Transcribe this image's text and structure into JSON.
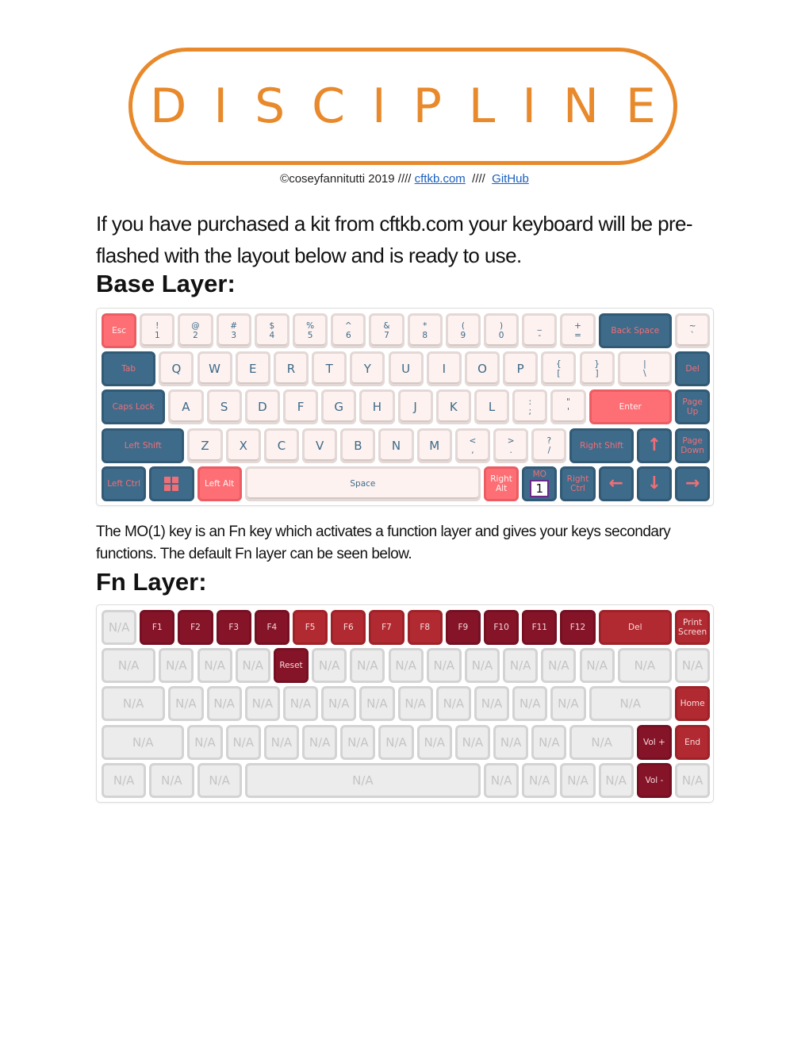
{
  "logo": {
    "text": "DISCIPLINE",
    "color": "#e8892b"
  },
  "credits": {
    "prefix": "©coseyfannitutti 2019 //// ",
    "link1": "cftkb.com",
    "sep": "  ////  ",
    "link2": "GitHub"
  },
  "intro": "If you have purchased a kit from cftkb.com your keyboard will be pre-flashed with the layout below and is ready to use.",
  "base_heading": "Base Layer:",
  "mo_paragraph": "The MO(1) key is an Fn key which activates a function layer and gives your keys secondary functions. The default Fn layer can be seen below.",
  "fn_heading": "Fn Layer:",
  "colors": {
    "navy": "#3e6b8a",
    "coral": "#fd6f75",
    "cream": "#fdf2ef",
    "maroon": "#861429",
    "crimson": "#b12a31",
    "gray": "#ececec"
  },
  "base_layer": [
    [
      {
        "label": "Esc",
        "style": "red"
      },
      {
        "top": "!",
        "bottom": "1",
        "style": "light"
      },
      {
        "top": "@",
        "bottom": "2",
        "style": "light"
      },
      {
        "top": "#",
        "bottom": "3",
        "style": "light"
      },
      {
        "top": "$",
        "bottom": "4",
        "style": "light"
      },
      {
        "top": "%",
        "bottom": "5",
        "style": "light"
      },
      {
        "top": "^",
        "bottom": "6",
        "style": "light"
      },
      {
        "top": "&",
        "bottom": "7",
        "style": "light"
      },
      {
        "top": "*",
        "bottom": "8",
        "style": "light"
      },
      {
        "top": "(",
        "bottom": "9",
        "style": "light"
      },
      {
        "top": ")",
        "bottom": "0",
        "style": "light"
      },
      {
        "top": "_",
        "bottom": "-",
        "style": "light"
      },
      {
        "top": "+",
        "bottom": "=",
        "style": "light"
      },
      {
        "label": "Back Space",
        "style": "blue"
      },
      {
        "top": "~",
        "bottom": "`",
        "style": "light"
      }
    ],
    [
      {
        "label": "Tab",
        "style": "blue"
      },
      {
        "label": "Q",
        "style": "light",
        "big": true
      },
      {
        "label": "W",
        "style": "light",
        "big": true
      },
      {
        "label": "E",
        "style": "light",
        "big": true
      },
      {
        "label": "R",
        "style": "light",
        "big": true
      },
      {
        "label": "T",
        "style": "light",
        "big": true
      },
      {
        "label": "Y",
        "style": "light",
        "big": true
      },
      {
        "label": "U",
        "style": "light",
        "big": true
      },
      {
        "label": "I",
        "style": "light",
        "big": true
      },
      {
        "label": "O",
        "style": "light",
        "big": true
      },
      {
        "label": "P",
        "style": "light",
        "big": true
      },
      {
        "top": "{",
        "bottom": "[",
        "style": "light"
      },
      {
        "top": "}",
        "bottom": "]",
        "style": "light"
      },
      {
        "top": "|",
        "bottom": "\\",
        "style": "light"
      },
      {
        "label": "Del",
        "style": "blue"
      }
    ],
    [
      {
        "label": "Caps Lock",
        "style": "blue"
      },
      {
        "label": "A",
        "style": "light",
        "big": true
      },
      {
        "label": "S",
        "style": "light",
        "big": true
      },
      {
        "label": "D",
        "style": "light",
        "big": true
      },
      {
        "label": "F",
        "style": "light",
        "big": true
      },
      {
        "label": "G",
        "style": "light",
        "big": true
      },
      {
        "label": "H",
        "style": "light",
        "big": true
      },
      {
        "label": "J",
        "style": "light",
        "big": true
      },
      {
        "label": "K",
        "style": "light",
        "big": true
      },
      {
        "label": "L",
        "style": "light",
        "big": true
      },
      {
        "top": ":",
        "bottom": ";",
        "style": "light"
      },
      {
        "top": "\"",
        "bottom": "'",
        "style": "light"
      },
      {
        "label": "Enter",
        "style": "red"
      },
      {
        "top": "Page",
        "bottom": "Up",
        "style": "blue"
      }
    ],
    [
      {
        "label": "Left Shift",
        "style": "blue"
      },
      {
        "label": "Z",
        "style": "light",
        "big": true
      },
      {
        "label": "X",
        "style": "light",
        "big": true
      },
      {
        "label": "C",
        "style": "light",
        "big": true
      },
      {
        "label": "V",
        "style": "light",
        "big": true
      },
      {
        "label": "B",
        "style": "light",
        "big": true
      },
      {
        "label": "N",
        "style": "light",
        "big": true
      },
      {
        "label": "M",
        "style": "light",
        "big": true
      },
      {
        "top": "<",
        "bottom": ",",
        "style": "light"
      },
      {
        "top": ">",
        "bottom": ".",
        "style": "light"
      },
      {
        "top": "?",
        "bottom": "/",
        "style": "light"
      },
      {
        "label": "Right Shift",
        "style": "blue"
      },
      {
        "icon": "arrow-up",
        "style": "blue"
      },
      {
        "top": "Page",
        "bottom": "Down",
        "style": "blue"
      }
    ],
    [
      {
        "label": "Left Ctrl",
        "style": "blue"
      },
      {
        "icon": "windows",
        "style": "blue"
      },
      {
        "label": "Left Alt",
        "style": "red"
      },
      {
        "label": "Space",
        "style": "light"
      },
      {
        "top": "Right",
        "bottom": "Alt",
        "style": "red"
      },
      {
        "top": "MO",
        "box": "1",
        "style": "blue"
      },
      {
        "top": "Right",
        "bottom": "Ctrl",
        "style": "blue"
      },
      {
        "icon": "arrow-left",
        "style": "blue"
      },
      {
        "icon": "arrow-down",
        "style": "blue"
      },
      {
        "icon": "arrow-right",
        "style": "blue"
      }
    ]
  ],
  "fn_layer": [
    [
      {
        "label": "N/A",
        "style": "na",
        "big": true
      },
      {
        "label": "F1",
        "style": "dark"
      },
      {
        "label": "F2",
        "style": "dark"
      },
      {
        "label": "F3",
        "style": "dark"
      },
      {
        "label": "F4",
        "style": "dark"
      },
      {
        "label": "F5",
        "style": "crim"
      },
      {
        "label": "F6",
        "style": "crim"
      },
      {
        "label": "F7",
        "style": "crim"
      },
      {
        "label": "F8",
        "style": "crim"
      },
      {
        "label": "F9",
        "style": "dark"
      },
      {
        "label": "F10",
        "style": "dark"
      },
      {
        "label": "F11",
        "style": "dark"
      },
      {
        "label": "F12",
        "style": "dark"
      },
      {
        "label": "Del",
        "style": "crim"
      },
      {
        "top": "Print",
        "bottom": "Screen",
        "style": "crim"
      }
    ],
    [
      {
        "label": "N/A",
        "style": "na",
        "big": true
      },
      {
        "label": "N/A",
        "style": "na",
        "big": true
      },
      {
        "label": "N/A",
        "style": "na",
        "big": true
      },
      {
        "label": "N/A",
        "style": "na",
        "big": true
      },
      {
        "label": "Reset",
        "style": "dark"
      },
      {
        "label": "N/A",
        "style": "na",
        "big": true
      },
      {
        "label": "N/A",
        "style": "na",
        "big": true
      },
      {
        "label": "N/A",
        "style": "na",
        "big": true
      },
      {
        "label": "N/A",
        "style": "na",
        "big": true
      },
      {
        "label": "N/A",
        "style": "na",
        "big": true
      },
      {
        "label": "N/A",
        "style": "na",
        "big": true
      },
      {
        "label": "N/A",
        "style": "na",
        "big": true
      },
      {
        "label": "N/A",
        "style": "na",
        "big": true
      },
      {
        "label": "N/A",
        "style": "na",
        "big": true
      },
      {
        "label": "N/A",
        "style": "na",
        "big": true
      }
    ],
    [
      {
        "label": "N/A",
        "style": "na",
        "big": true
      },
      {
        "label": "N/A",
        "style": "na",
        "big": true
      },
      {
        "label": "N/A",
        "style": "na",
        "big": true
      },
      {
        "label": "N/A",
        "style": "na",
        "big": true
      },
      {
        "label": "N/A",
        "style": "na",
        "big": true
      },
      {
        "label": "N/A",
        "style": "na",
        "big": true
      },
      {
        "label": "N/A",
        "style": "na",
        "big": true
      },
      {
        "label": "N/A",
        "style": "na",
        "big": true
      },
      {
        "label": "N/A",
        "style": "na",
        "big": true
      },
      {
        "label": "N/A",
        "style": "na",
        "big": true
      },
      {
        "label": "N/A",
        "style": "na",
        "big": true
      },
      {
        "label": "N/A",
        "style": "na",
        "big": true
      },
      {
        "label": "N/A",
        "style": "na",
        "big": true
      },
      {
        "label": "Home",
        "style": "crim"
      }
    ],
    [
      {
        "label": "N/A",
        "style": "na",
        "big": true
      },
      {
        "label": "N/A",
        "style": "na",
        "big": true
      },
      {
        "label": "N/A",
        "style": "na",
        "big": true
      },
      {
        "label": "N/A",
        "style": "na",
        "big": true
      },
      {
        "label": "N/A",
        "style": "na",
        "big": true
      },
      {
        "label": "N/A",
        "style": "na",
        "big": true
      },
      {
        "label": "N/A",
        "style": "na",
        "big": true
      },
      {
        "label": "N/A",
        "style": "na",
        "big": true
      },
      {
        "label": "N/A",
        "style": "na",
        "big": true
      },
      {
        "label": "N/A",
        "style": "na",
        "big": true
      },
      {
        "label": "N/A",
        "style": "na",
        "big": true
      },
      {
        "label": "N/A",
        "style": "na",
        "big": true
      },
      {
        "label": "Vol +",
        "style": "dark"
      },
      {
        "label": "End",
        "style": "crim"
      }
    ],
    [
      {
        "label": "N/A",
        "style": "na",
        "big": true
      },
      {
        "label": "N/A",
        "style": "na",
        "big": true
      },
      {
        "label": "N/A",
        "style": "na",
        "big": true
      },
      {
        "label": "N/A",
        "style": "na",
        "big": true
      },
      {
        "label": "N/A",
        "style": "na",
        "big": true
      },
      {
        "label": "N/A",
        "style": "na",
        "big": true
      },
      {
        "label": "N/A",
        "style": "na",
        "big": true
      },
      {
        "label": "N/A",
        "style": "na",
        "big": true
      },
      {
        "label": "Vol -",
        "style": "dark"
      },
      {
        "label": "N/A",
        "style": "na",
        "big": true
      }
    ]
  ]
}
